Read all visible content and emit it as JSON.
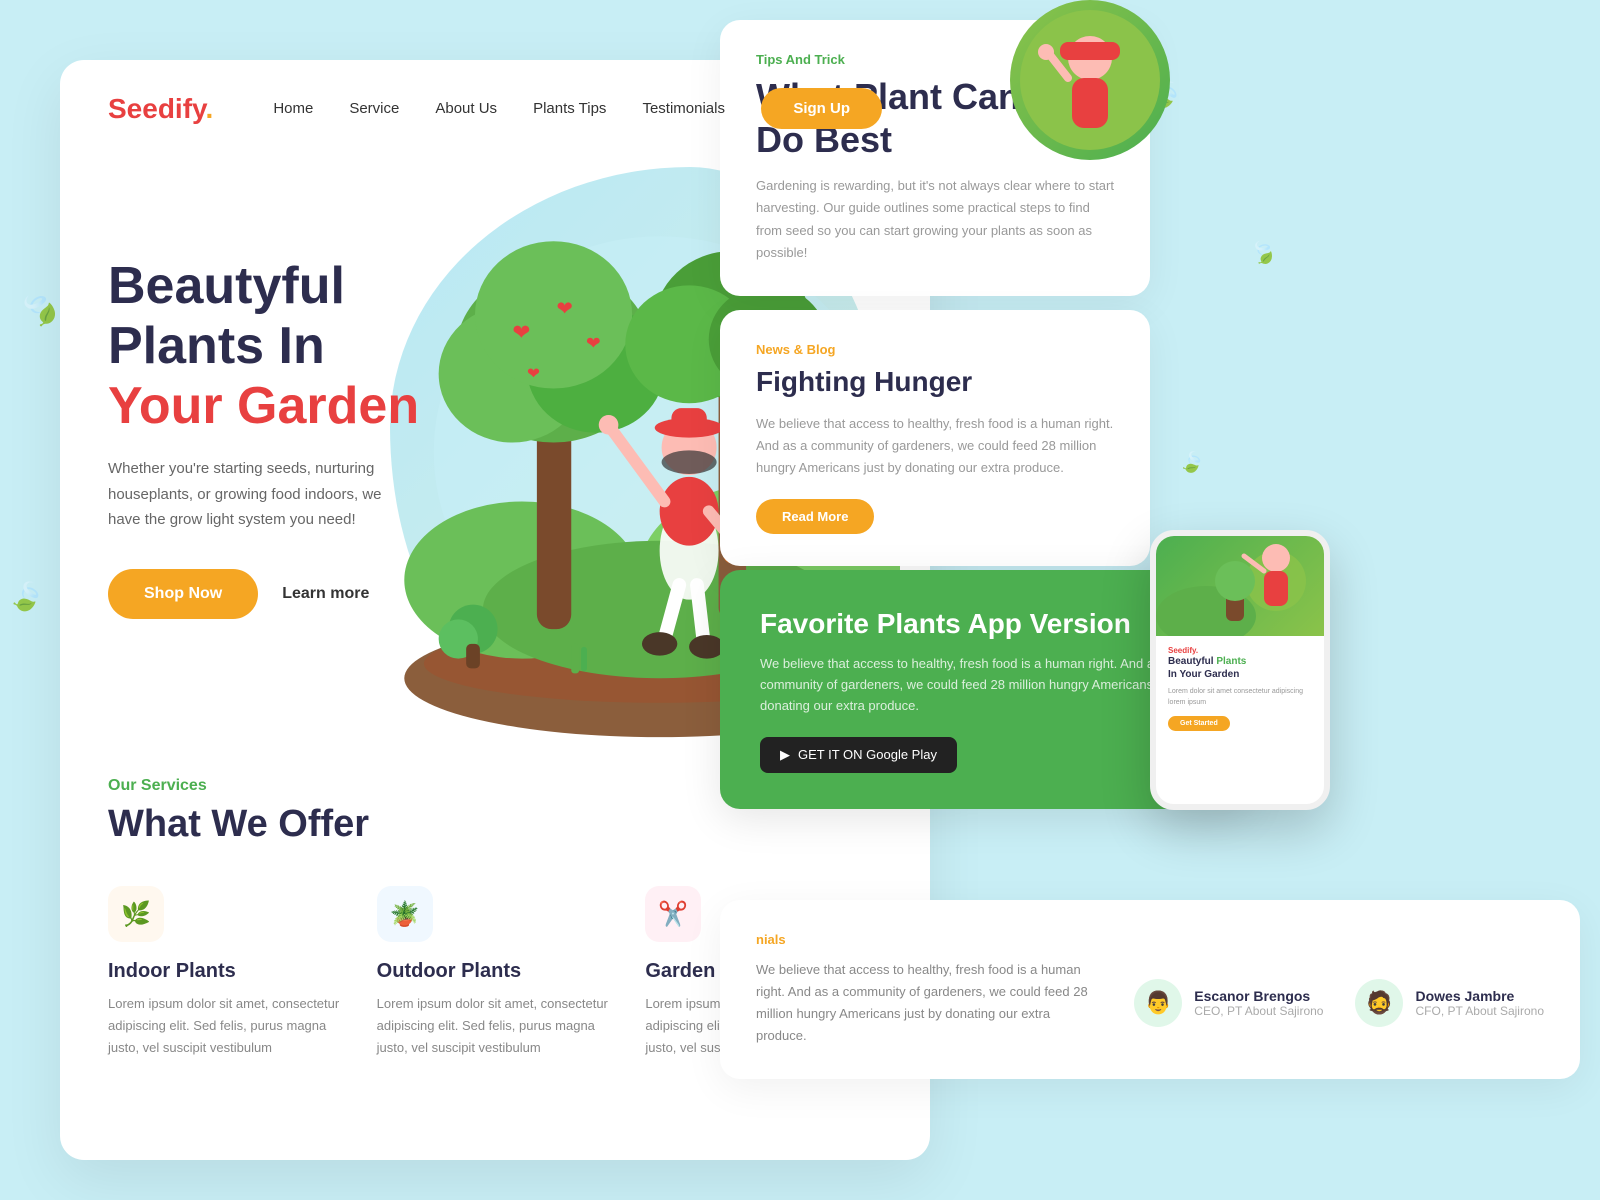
{
  "brand": {
    "name": "Seedify",
    "dot": "."
  },
  "nav": {
    "links": [
      {
        "label": "Home",
        "href": "#"
      },
      {
        "label": "Service",
        "href": "#"
      },
      {
        "label": "About Us",
        "href": "#"
      },
      {
        "label": "Plants Tips",
        "href": "#"
      },
      {
        "label": "Testimonials",
        "href": "#"
      }
    ],
    "signup_label": "Sign Up"
  },
  "hero": {
    "title_line1": "Beautyful",
    "title_line2": "Plants In",
    "title_highlight": "Your Garden",
    "description": "Whether you're starting seeds, nurturing houseplants, or growing food indoors, we have the grow light system you need!",
    "btn_shop": "Shop Now",
    "btn_learn": "Learn more"
  },
  "services": {
    "section_label": "Our Services",
    "section_title": "What We Offer",
    "cards": [
      {
        "icon": "🌿",
        "title": "Indoor Plants",
        "desc": "Lorem ipsum dolor sit amet, consectetur adipiscing elit. Sed felis, purus magna justo, vel suscipit vestibulum"
      },
      {
        "icon": "🪴",
        "title": "Outdoor Plants",
        "desc": "Lorem ipsum dolor sit amet, consectetur adipiscing elit. Sed felis, purus magna justo, vel suscipit vestibulum"
      },
      {
        "icon": "✂️",
        "title": "Garden Care",
        "desc": "Lorem ipsum dolor sit amet, consectetur adipiscing elit. Sed felis, purus magna justo, vel suscipit vestibulum"
      }
    ]
  },
  "tips": {
    "label": "Tips And Trick",
    "title_line1": "What Plant Can",
    "title_line2": "Do Best",
    "desc": "Gardening is rewarding, but it's not always clear where to start harvesting. Our guide outlines some practical steps to find from seed so you can start growing your plants as soon as possible!"
  },
  "news": {
    "label": "News & Blog",
    "title": "Fighting Hunger",
    "desc": "We believe that access to healthy, fresh food is a human right. And as a community of gardeners, we could feed 28 million hungry Americans just by donating our extra produce.",
    "btn_label": "Read More"
  },
  "app": {
    "title": "Favorite Plants App Version",
    "desc": "We believe that access to healthy, fresh food is a human right. And as a community of gardeners, we could feed 28 million hungry Americans just by donating our extra produce.",
    "store_label": "GET IT ON Google Play",
    "phone_brand": "Seedify.",
    "phone_title": "Beautyful Plants In Your Garden",
    "phone_desc": "Lorem dolor sit amet consectetur adipiscing lorem ipsum",
    "phone_btn": "Get Started"
  },
  "testimonials": {
    "label": "nials",
    "desc": "We believe that access to healthy, fresh food is a human right. And as a community of gardeners, we could feed 28 million hungry Americans just by donating our extra produce.",
    "persons": [
      {
        "name": "Escanor Brengos",
        "role": "CEO, PT About Sajirono",
        "avatar": "👨"
      },
      {
        "name": "Dowes Jambre",
        "role": "CFO, PT About Sajirono",
        "avatar": "🧔"
      }
    ]
  },
  "colors": {
    "brand_red": "#e84040",
    "accent_orange": "#f5a623",
    "green": "#4caf50",
    "dark": "#2d2d4e",
    "light_bg": "#c8eef5"
  }
}
